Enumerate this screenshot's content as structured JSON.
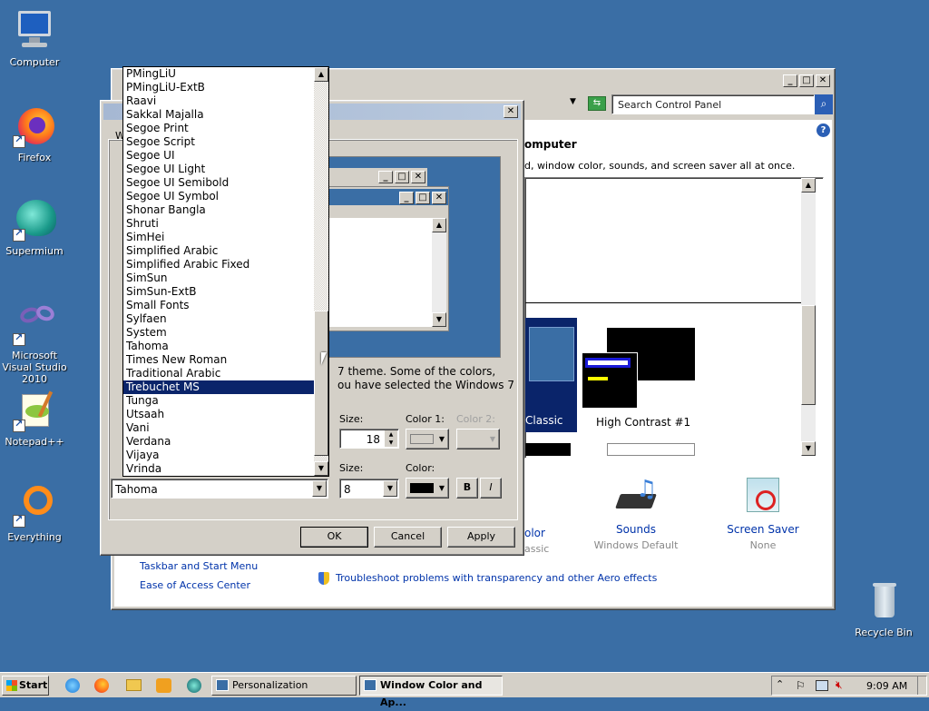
{
  "desktop": {
    "icons": [
      {
        "label": "Computer"
      },
      {
        "label": "Firefox"
      },
      {
        "label": "Supermium"
      },
      {
        "label": "Microsoft Visual Studio 2010"
      },
      {
        "label": "Notepad++"
      },
      {
        "label": "Everything"
      },
      {
        "label": "Recycle Bin"
      }
    ]
  },
  "control_panel": {
    "search_placeholder": "Search Control Panel",
    "heading": "omputer",
    "subtitle": "d, window color, sounds, and screen saver all at once.",
    "themes": [
      {
        "label": "Classic"
      },
      {
        "label": "High Contrast #1"
      }
    ],
    "bottom_items": [
      {
        "label": "olor",
        "sub": "assic"
      },
      {
        "label": "Sounds",
        "sub": "Windows Default"
      },
      {
        "label": "Screen Saver",
        "sub": "None"
      }
    ],
    "see_also": [
      "Taskbar and Start Menu",
      "Ease of Access Center"
    ],
    "troubleshoot_link": "Troubleshoot problems with transparency and other Aero effects"
  },
  "dialog": {
    "tab_fragment": "W",
    "info_line1": "7 theme.  Some of the colors,",
    "info_line2": "ou have selected the Windows 7",
    "size_label": "Size:",
    "color1_label": "Color 1:",
    "color2_label": "Color 2:",
    "size_value": "18",
    "font_size_label": "Size:",
    "font_color_label": "Color:",
    "font_size_value": "8",
    "font_value": "Tahoma",
    "bold_label": "B",
    "italic_label": "I",
    "ok_label": "OK",
    "cancel_label": "Cancel",
    "apply_label": "Apply"
  },
  "font_list": {
    "items": [
      "PMingLiU",
      "PMingLiU-ExtB",
      "Raavi",
      "Sakkal Majalla",
      "Segoe Print",
      "Segoe Script",
      "Segoe UI",
      "Segoe UI Light",
      "Segoe UI Semibold",
      "Segoe UI Symbol",
      "Shonar Bangla",
      "Shruti",
      "SimHei",
      "Simplified Arabic",
      "Simplified Arabic Fixed",
      "SimSun",
      "SimSun-ExtB",
      "Small Fonts",
      "Sylfaen",
      "System",
      "Tahoma",
      "Times New Roman",
      "Traditional Arabic",
      "Trebuchet MS",
      "Tunga",
      "Utsaah",
      "Vani",
      "Verdana",
      "Vijaya",
      "Vrinda"
    ],
    "selected": "Trebuchet MS"
  },
  "taskbar": {
    "start_label": "Start",
    "tasks": [
      {
        "label": "Personalization",
        "active": false
      },
      {
        "label": "Window Color and Ap...",
        "active": true
      }
    ],
    "clock": "9:09 AM"
  },
  "colors": {
    "desktop": "#3a6ea5",
    "selection": "#0a246a",
    "link": "#0033aa"
  }
}
